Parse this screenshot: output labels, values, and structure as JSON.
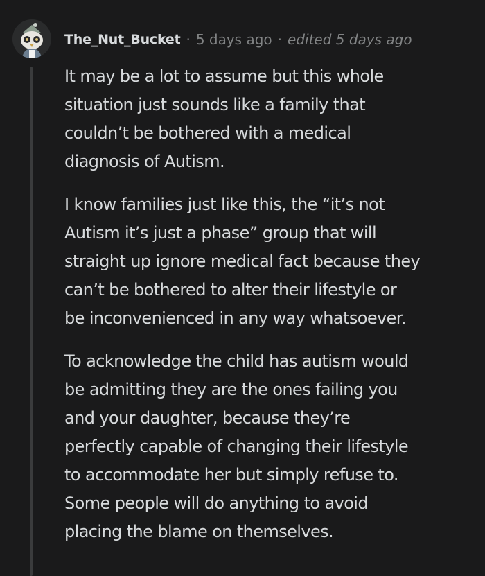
{
  "comment": {
    "author": "The_Nut_Bucket",
    "separator": "·",
    "timestamp": "5 days ago",
    "edited": "edited 5 days ago",
    "avatar_icon": "owl-avatar-icon",
    "paragraphs": [
      {
        "lines": [
          "It may be a lot to assume but this whole",
          "situation just sounds like a family that",
          "couldn’t be bothered with a medical",
          "diagnosis of Autism."
        ]
      },
      {
        "lines": [
          "I know families just like this, the “it’s not",
          "Autism it’s just a phase” group that will",
          "straight up ignore medical fact because they",
          "can’t be bothered to alter their lifestyle or",
          "be inconvenienced in any way whatsoever."
        ]
      },
      {
        "lines": [
          "To acknowledge the child has autism would",
          "be admitting they are the ones failing you",
          "and your daughter, because they’re",
          "perfectly capable of changing their lifestyle",
          "to accommodate her but simply refuse to.",
          "Some people will do anything to avoid",
          "placing the blame on themselves."
        ]
      }
    ]
  },
  "colors": {
    "background": "#1a1a1b",
    "text": "#d7dadc",
    "meta": "#818384",
    "thread_line": "#3a3b3c"
  }
}
